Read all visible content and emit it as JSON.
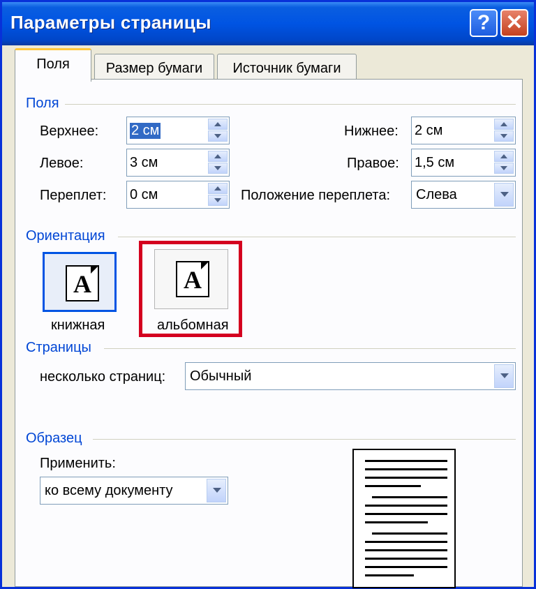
{
  "window": {
    "title": "Параметры страницы"
  },
  "titlebar_buttons": {
    "help": "?",
    "close": "✕"
  },
  "tabs": [
    {
      "label": "Поля",
      "active": true
    },
    {
      "label": "Размер бумаги",
      "active": false
    },
    {
      "label": "Источник бумаги",
      "active": false
    }
  ],
  "margins": {
    "group_label": "Поля",
    "top": {
      "label": "Верхнее:",
      "value": "2 см"
    },
    "bottom": {
      "label": "Нижнее:",
      "value": "2 см"
    },
    "left": {
      "label": "Левое:",
      "value": "3 см"
    },
    "right": {
      "label": "Правое:",
      "value": "1,5 см"
    },
    "gutter": {
      "label": "Переплет:",
      "value": "0 см"
    },
    "gutter_position": {
      "label": "Положение переплета:",
      "value": "Слева"
    }
  },
  "orientation": {
    "group_label": "Ориентация",
    "portrait": {
      "label": "книжная",
      "glyph": "A"
    },
    "landscape": {
      "label": "альбомная",
      "glyph": "A",
      "highlight_color": "#d4001f"
    }
  },
  "pages": {
    "group_label": "Страницы",
    "multiple_label": "несколько страниц:",
    "multiple_value": "Обычный"
  },
  "sample": {
    "group_label": "Образец",
    "apply_label": "Применить:",
    "apply_value": "ко всему документу"
  },
  "colors": {
    "titlebar": "#0054e3",
    "group_text": "#0046d5",
    "selection": "#316ac5"
  }
}
